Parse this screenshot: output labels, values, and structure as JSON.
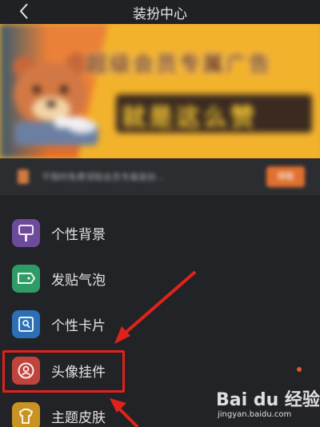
{
  "header": {
    "title": "装扮中心",
    "back_icon": "chevron-left-icon"
  },
  "banner": {
    "headline": "超级会员专属广告",
    "subline": "就是这么赞",
    "colors": {
      "left": "#ef7f33",
      "right": "#f3b22c",
      "headline": "#7a3f10",
      "subline": "#f4c531"
    }
  },
  "notice": {
    "text": "不限时免费领取会员专属装扮…",
    "button": "领取"
  },
  "menu": {
    "items": [
      {
        "label": "个性背景",
        "icon": "brush-icon",
        "color": "#6d4b9a"
      },
      {
        "label": "发贴气泡",
        "icon": "speech-bubble-icon",
        "color": "#2f9c68"
      },
      {
        "label": "个性卡片",
        "icon": "card-icon",
        "color": "#2d6fb6"
      },
      {
        "label": "头像挂件",
        "icon": "avatar-frame-icon",
        "color": "#c0443c"
      },
      {
        "label": "主题皮肤",
        "icon": "tshirt-icon",
        "color": "#c99324"
      }
    ]
  },
  "annotation": {
    "highlight_color": "#e0221c"
  },
  "watermark": {
    "brand": "Bai du 经验",
    "url": "jingyan.baidu.com"
  }
}
